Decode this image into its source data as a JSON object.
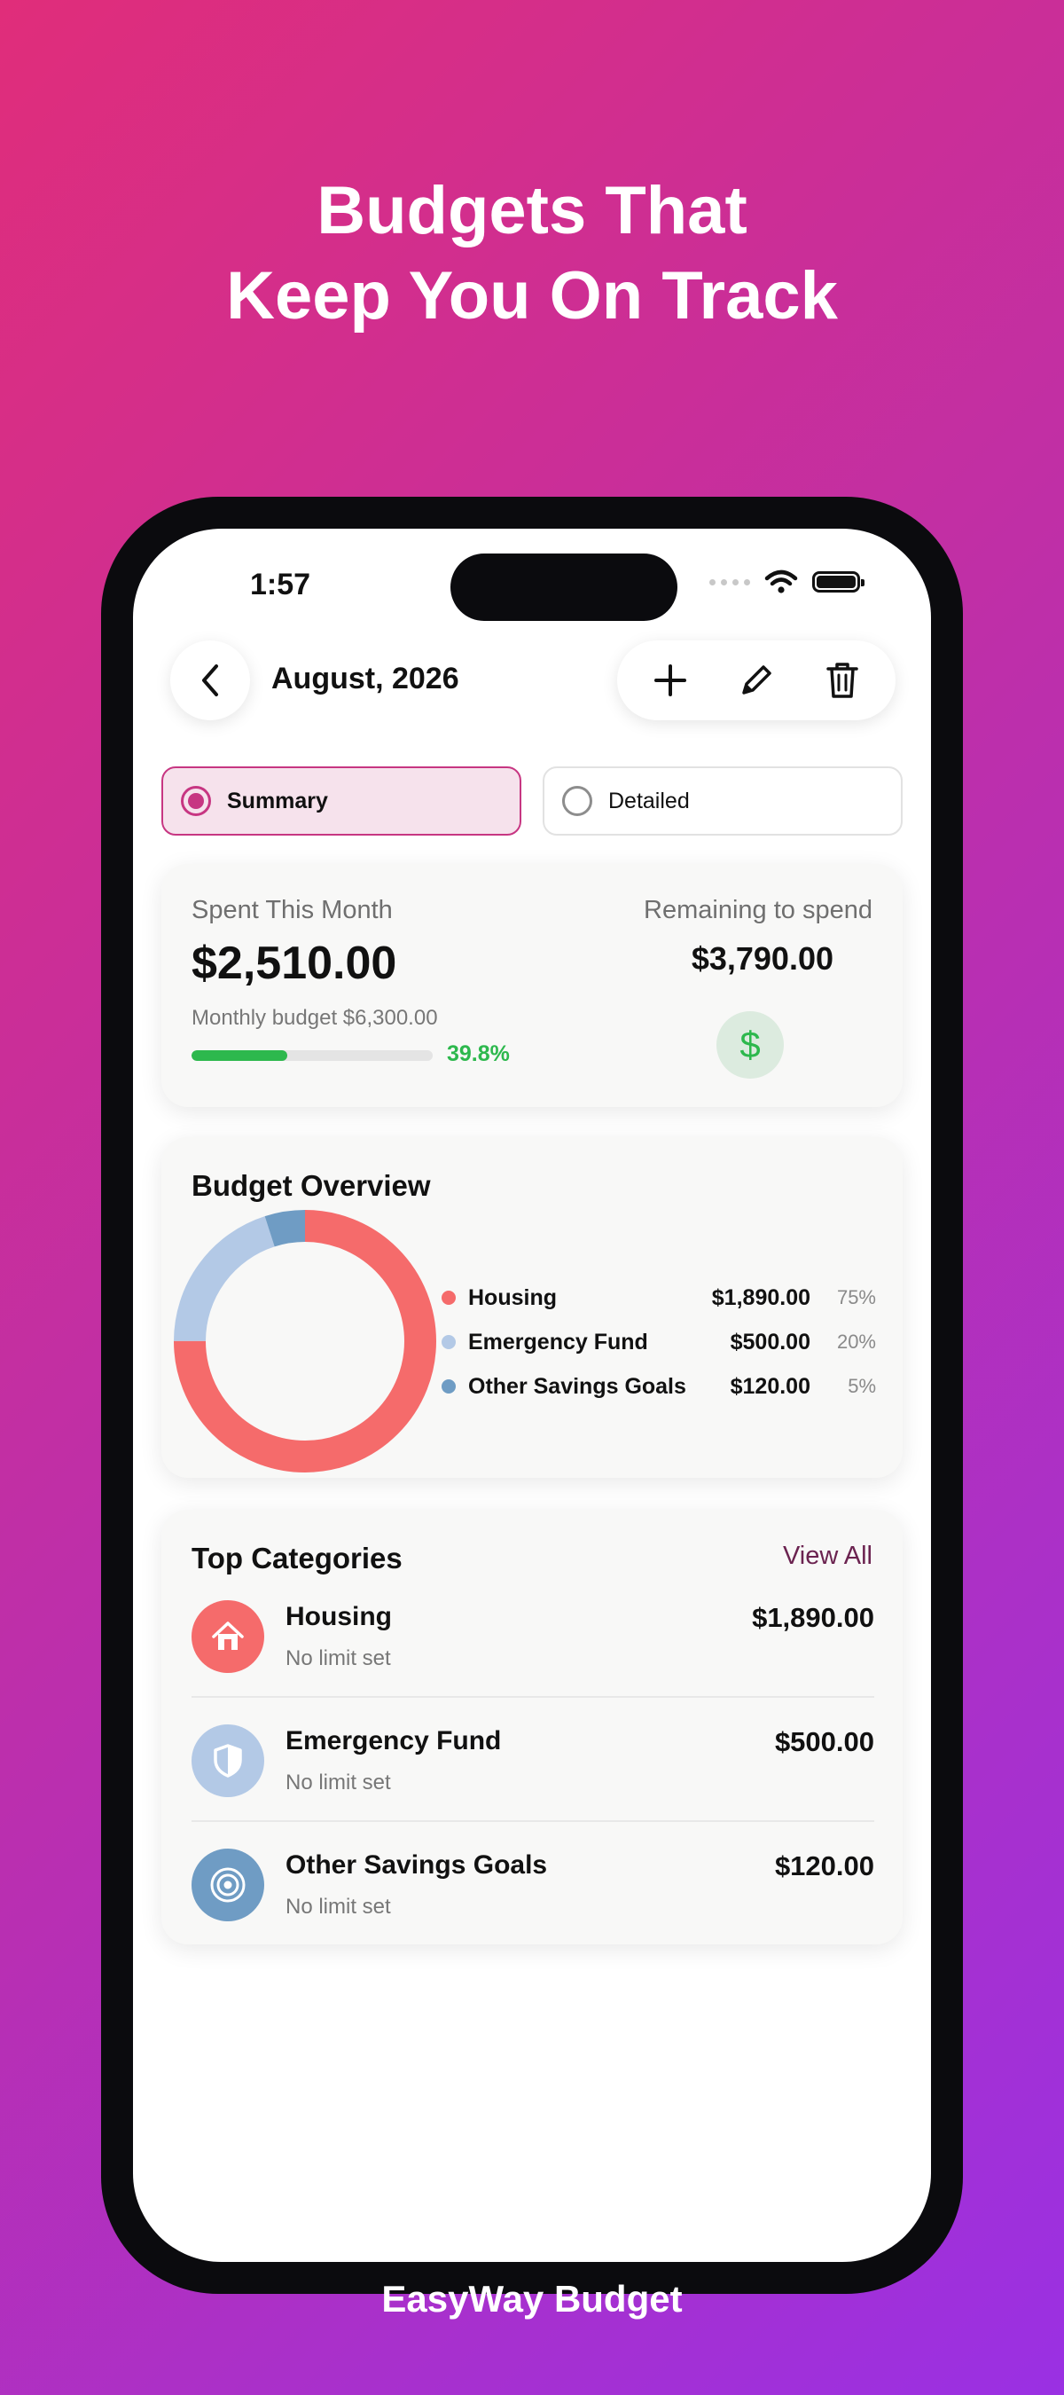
{
  "headline": {
    "line1": "Budgets That",
    "line2": "Keep You On Track"
  },
  "status_bar": {
    "time": "1:57"
  },
  "header": {
    "title": "August, 2026"
  },
  "segments": {
    "summary": "Summary",
    "detailed": "Detailed",
    "selected": "Summary"
  },
  "spent_card": {
    "spent_label": "Spent This Month",
    "spent_amount": "$2,510.00",
    "budget_line": "Monthly budget $6,300.00",
    "progress_percent": 39.8,
    "progress_text": "39.8%",
    "remaining_label": "Remaining to spend",
    "remaining_amount": "$3,790.00",
    "icon": "dollar-icon"
  },
  "overview": {
    "title": "Budget Overview",
    "items": [
      {
        "name": "Housing",
        "amount": "$1,890.00",
        "percent": "75%",
        "value": 75,
        "color": "#f56b6b"
      },
      {
        "name": "Emergency Fund",
        "amount": "$500.00",
        "percent": "20%",
        "value": 20,
        "color": "#b3c9e6"
      },
      {
        "name": "Other Savings Goals",
        "amount": "$120.00",
        "percent": "5%",
        "value": 5,
        "color": "#6f9cc4"
      }
    ]
  },
  "top_categories": {
    "title": "Top Categories",
    "view_all": "View All",
    "items": [
      {
        "name": "Housing",
        "sub": "No limit set",
        "amount": "$1,890.00",
        "icon": "home-icon",
        "color": "#f56b6b"
      },
      {
        "name": "Emergency Fund",
        "sub": "No limit set",
        "amount": "$500.00",
        "icon": "shield-icon",
        "color": "#b3c9e6"
      },
      {
        "name": "Other Savings Goals",
        "sub": "No limit set",
        "amount": "$120.00",
        "icon": "target-icon",
        "color": "#6f9cc4"
      }
    ]
  },
  "footer": {
    "brand": "EasyWay Budget"
  }
}
